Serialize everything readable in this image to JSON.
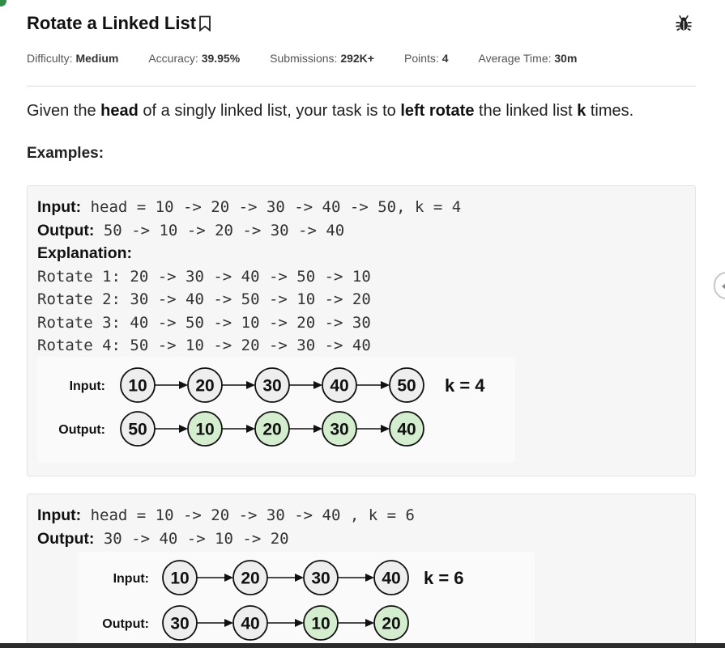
{
  "problem": {
    "title": "Rotate a Linked List",
    "meta": [
      {
        "label": "Difficulty:",
        "value": "Medium"
      },
      {
        "label": "Accuracy:",
        "value": "39.95%"
      },
      {
        "label": "Submissions:",
        "value": "292K+"
      },
      {
        "label": "Points:",
        "value": "4"
      },
      {
        "label": "Average Time:",
        "value": "30m"
      }
    ],
    "statement": {
      "t1": "Given the ",
      "b1": "head",
      "t2": " of a singly linked list, your task is to ",
      "b2": "left rotate",
      "t3": " the linked list ",
      "b3": "k",
      "t4": " times."
    },
    "examples_title": "Examples:"
  },
  "example1": {
    "input_label": "Input:",
    "input_value": " head = 10 -> 20 -> 30 -> 40 -> 50, k = 4",
    "output_label": "Output:",
    "output_value": " 50 -> 10 -> 20 -> 30 -> 40",
    "explanation_label": "Explanation:",
    "lines": [
      "Rotate 1: 20 -> 30 -> 40 -> 50 -> 10",
      "Rotate 2: 30 -> 40 -> 50 -> 10 -> 20",
      "Rotate 3: 40 -> 50 -> 10 -> 20 -> 30",
      "Rotate 4: 50 -> 10 -> 20 -> 30 -> 40"
    ],
    "diagram": {
      "input_label": "Input:",
      "output_label": "Output:",
      "input_nodes": [
        "10",
        "20",
        "30",
        "40",
        "50"
      ],
      "output_nodes": [
        "50",
        "10",
        "20",
        "30",
        "40"
      ],
      "output_highlighted": [
        false,
        true,
        true,
        true,
        true
      ],
      "k_text": "k = 4"
    }
  },
  "example2": {
    "input_label": "Input:",
    "input_value": " head = 10 -> 20 -> 30 -> 40 , k = 6",
    "output_label": "Output:",
    "output_value": " 30 -> 40 -> 10 -> 20",
    "diagram": {
      "input_label": "Input:",
      "output_label": "Output:",
      "input_nodes": [
        "10",
        "20",
        "30",
        "40"
      ],
      "output_nodes": [
        "30",
        "40",
        "10",
        "20"
      ],
      "output_highlighted": [
        false,
        false,
        true,
        true
      ],
      "k_text": "k = 6"
    }
  },
  "colors": {
    "node_fill": "#eeeeee",
    "node_highlight": "#d4edcf",
    "brand_green": "#2f8d46"
  },
  "icons": [
    "bookmark-icon",
    "bug-icon"
  ]
}
